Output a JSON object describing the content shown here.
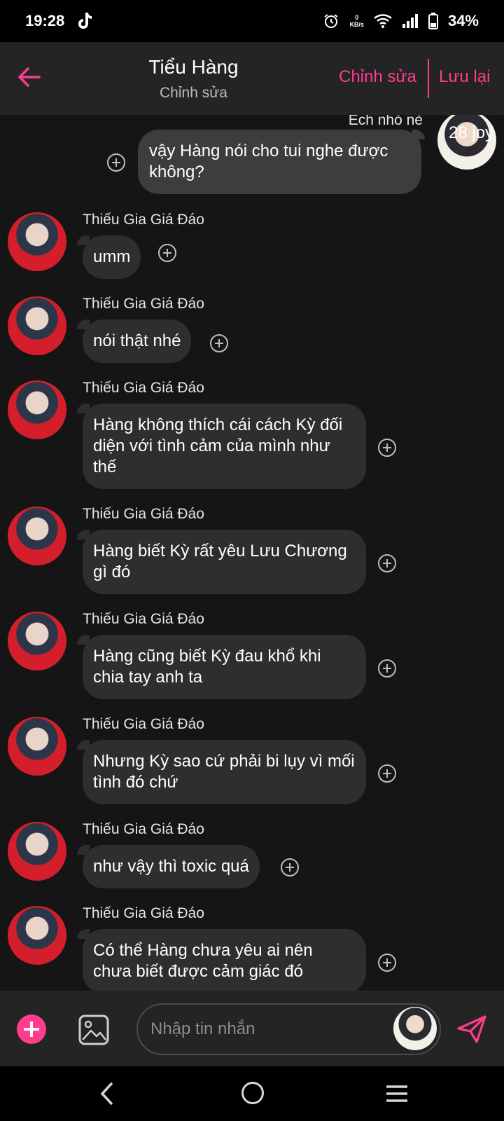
{
  "status": {
    "time": "19:28",
    "net_speed_value": "0",
    "net_speed_unit": "KB/s",
    "battery": "34%"
  },
  "header": {
    "title": "Tiểu Hàng",
    "subtitle": "Chỉnh sửa",
    "edit_label": "Chỉnh sửa",
    "save_label": "Lưu lại"
  },
  "own_message": {
    "name": "Ếch nhỏ nè",
    "avatar_label": "28 joy",
    "text": "vậy Hàng nói cho tui nghe được không?"
  },
  "messages": [
    {
      "sender": "Thiếu Gia Giá Đáo",
      "text": "umm"
    },
    {
      "sender": "Thiếu Gia Giá Đáo",
      "text": "nói thật nhé"
    },
    {
      "sender": "Thiếu Gia Giá Đáo",
      "text": "Hàng không thích cái cách Kỳ đối diện với tình cảm của mình như thế"
    },
    {
      "sender": "Thiếu Gia Giá Đáo",
      "text": "Hàng biết Kỳ rất yêu Lưu Chương gì đó"
    },
    {
      "sender": "Thiếu Gia Giá Đáo",
      "text": "Hàng cũng biết Kỳ đau khổ khi chia tay anh ta"
    },
    {
      "sender": "Thiếu Gia Giá Đáo",
      "text": "Nhưng Kỳ sao cứ phải bi lụy vì mối tình đó chứ"
    },
    {
      "sender": "Thiếu Gia Giá Đáo",
      "text": "như vậy thì toxic quá"
    },
    {
      "sender": "Thiếu Gia Giá Đáo",
      "text": "Có thể Hàng chưa yêu ai nên chưa biết được cảm giác đó"
    }
  ],
  "composer": {
    "placeholder": "Nhập tin nhắn"
  },
  "icons": {
    "back": "arrow-left-icon",
    "add": "plus-icon",
    "image": "image-icon",
    "send": "send-icon",
    "react": "add-reaction-icon"
  },
  "colors": {
    "accent": "#ff3c8e",
    "background": "#151515",
    "header": "#242424",
    "bubble": "#2e2e2e"
  }
}
